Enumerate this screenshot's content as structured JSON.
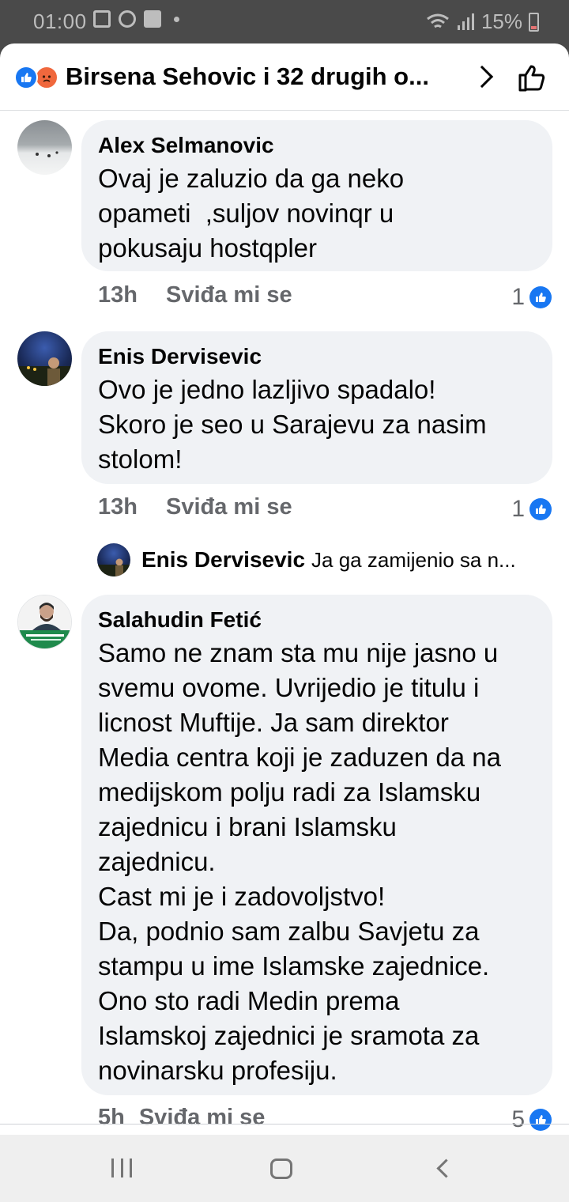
{
  "status_bar": {
    "time": "01:00",
    "battery": "15%",
    "icons": [
      "gallery-icon",
      "sync-icon",
      "facebook-icon",
      "dot-icon",
      "wifi-icon",
      "signal-icon",
      "battery-icon"
    ]
  },
  "header": {
    "title": "Birsena Sehovic i 32 drugih o...",
    "reaction_icons": [
      "like-reaction-icon",
      "angry-reaction-icon"
    ],
    "like_button_icon": "thumbs-up-outline-icon"
  },
  "comments": [
    {
      "author": "Alex Selmanovic",
      "text": "Ovaj je zaluzio da ga neko\nopameti  ,suljov novinqr u\npokusaju hostqpler",
      "time": "13h",
      "like_label": "Sviđa mi se",
      "likes": "1"
    },
    {
      "author": "Enis Dervisevic",
      "text": "Ovo je jedno lazljivo spadalo!\nSkoro je seo u Sarajevu za nasim\nstolom!",
      "time": "13h",
      "like_label": "Sviđa mi se",
      "likes": "1",
      "reply": {
        "author": "Enis Dervisevic",
        "text": "Ja ga zamijenio sa n..."
      }
    },
    {
      "author": "Salahudin Fetić",
      "text": "Samo ne znam sta mu nije jasno u\nsvemu ovome. Uvrijedio je titulu i\nlicnost Muftije. Ja sam direktor\nMedia centra koji je zaduzen da na\nmedijskom polju radi za Islamsku\nzajednicu i brani Islamsku\nzajednicu.\nCast mi je i zadovoljstvo!\nDa, podnio sam zalbu Savjetu za\nstampu u ime Islamske zajednice.\nOno sto radi Medin prema\nIslamskoj zajednici je sramota za\nnovinarsku profesiju.",
      "time": "5h",
      "like_label": "Sviđa mi se",
      "likes": "5"
    }
  ],
  "colors": {
    "accent": "#1877f2",
    "bubble": "#f0f2f5",
    "meta_text": "#65676b"
  }
}
